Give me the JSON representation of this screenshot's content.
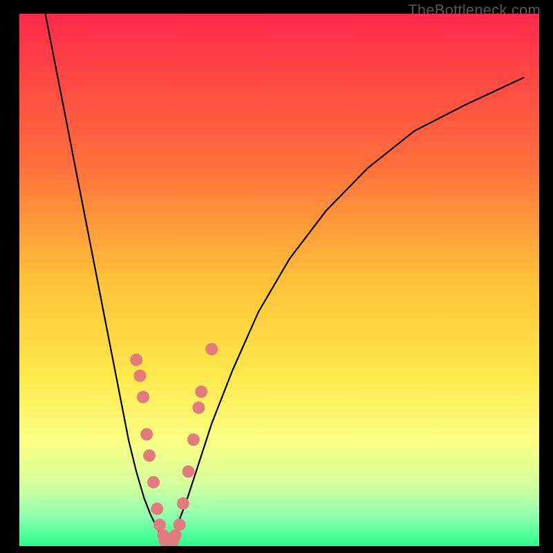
{
  "watermark": "TheBottleneck.com",
  "chart_data": {
    "type": "line",
    "title": "",
    "xlabel": "",
    "ylabel": "",
    "xlim": [
      0,
      100
    ],
    "ylim": [
      0,
      100
    ],
    "grid": false,
    "legend": false,
    "background_gradient": [
      {
        "stop": 0.0,
        "color": "#ff2a4b"
      },
      {
        "stop": 0.28,
        "color": "#ff6e3c"
      },
      {
        "stop": 0.5,
        "color": "#ffc13a"
      },
      {
        "stop": 0.68,
        "color": "#ffe94a"
      },
      {
        "stop": 0.8,
        "color": "#fbff82"
      },
      {
        "stop": 0.88,
        "color": "#d7ff9a"
      },
      {
        "stop": 0.94,
        "color": "#94ffb0"
      },
      {
        "stop": 1.0,
        "color": "#2bff8e"
      }
    ],
    "series": [
      {
        "name": "left-curve",
        "stroke": "#000000",
        "x": [
          5,
          7,
          9,
          11,
          13,
          15,
          17,
          19,
          21,
          22.5,
          24,
          25.2,
          26.2,
          27,
          27.8,
          28.5
        ],
        "y": [
          100,
          90,
          80,
          70,
          60,
          50,
          40,
          30,
          20,
          14,
          9,
          6,
          4,
          2.5,
          1.3,
          0.6
        ]
      },
      {
        "name": "right-curve",
        "stroke": "#000000",
        "x": [
          28.5,
          30,
          32,
          34,
          37,
          41,
          46,
          52,
          59,
          67,
          76,
          86,
          97
        ],
        "y": [
          0.6,
          3,
          8,
          14,
          23,
          33,
          44,
          54,
          63,
          71,
          78,
          83,
          88
        ]
      }
    ],
    "scatter": {
      "name": "data-points",
      "color": "#e27c7c",
      "points": [
        {
          "x": 22.5,
          "y": 35
        },
        {
          "x": 23.2,
          "y": 32
        },
        {
          "x": 23.8,
          "y": 28
        },
        {
          "x": 24.5,
          "y": 21
        },
        {
          "x": 25.0,
          "y": 17
        },
        {
          "x": 25.8,
          "y": 12
        },
        {
          "x": 26.5,
          "y": 7
        },
        {
          "x": 27.0,
          "y": 4
        },
        {
          "x": 27.7,
          "y": 2
        },
        {
          "x": 28.0,
          "y": 1
        },
        {
          "x": 28.5,
          "y": 0.5
        },
        {
          "x": 29.0,
          "y": 0.5
        },
        {
          "x": 29.5,
          "y": 0.8
        },
        {
          "x": 30.0,
          "y": 2
        },
        {
          "x": 30.8,
          "y": 4
        },
        {
          "x": 31.5,
          "y": 8
        },
        {
          "x": 32.5,
          "y": 14
        },
        {
          "x": 33.5,
          "y": 20
        },
        {
          "x": 34.5,
          "y": 26
        },
        {
          "x": 35.0,
          "y": 29
        },
        {
          "x": 37.0,
          "y": 37
        }
      ]
    }
  }
}
